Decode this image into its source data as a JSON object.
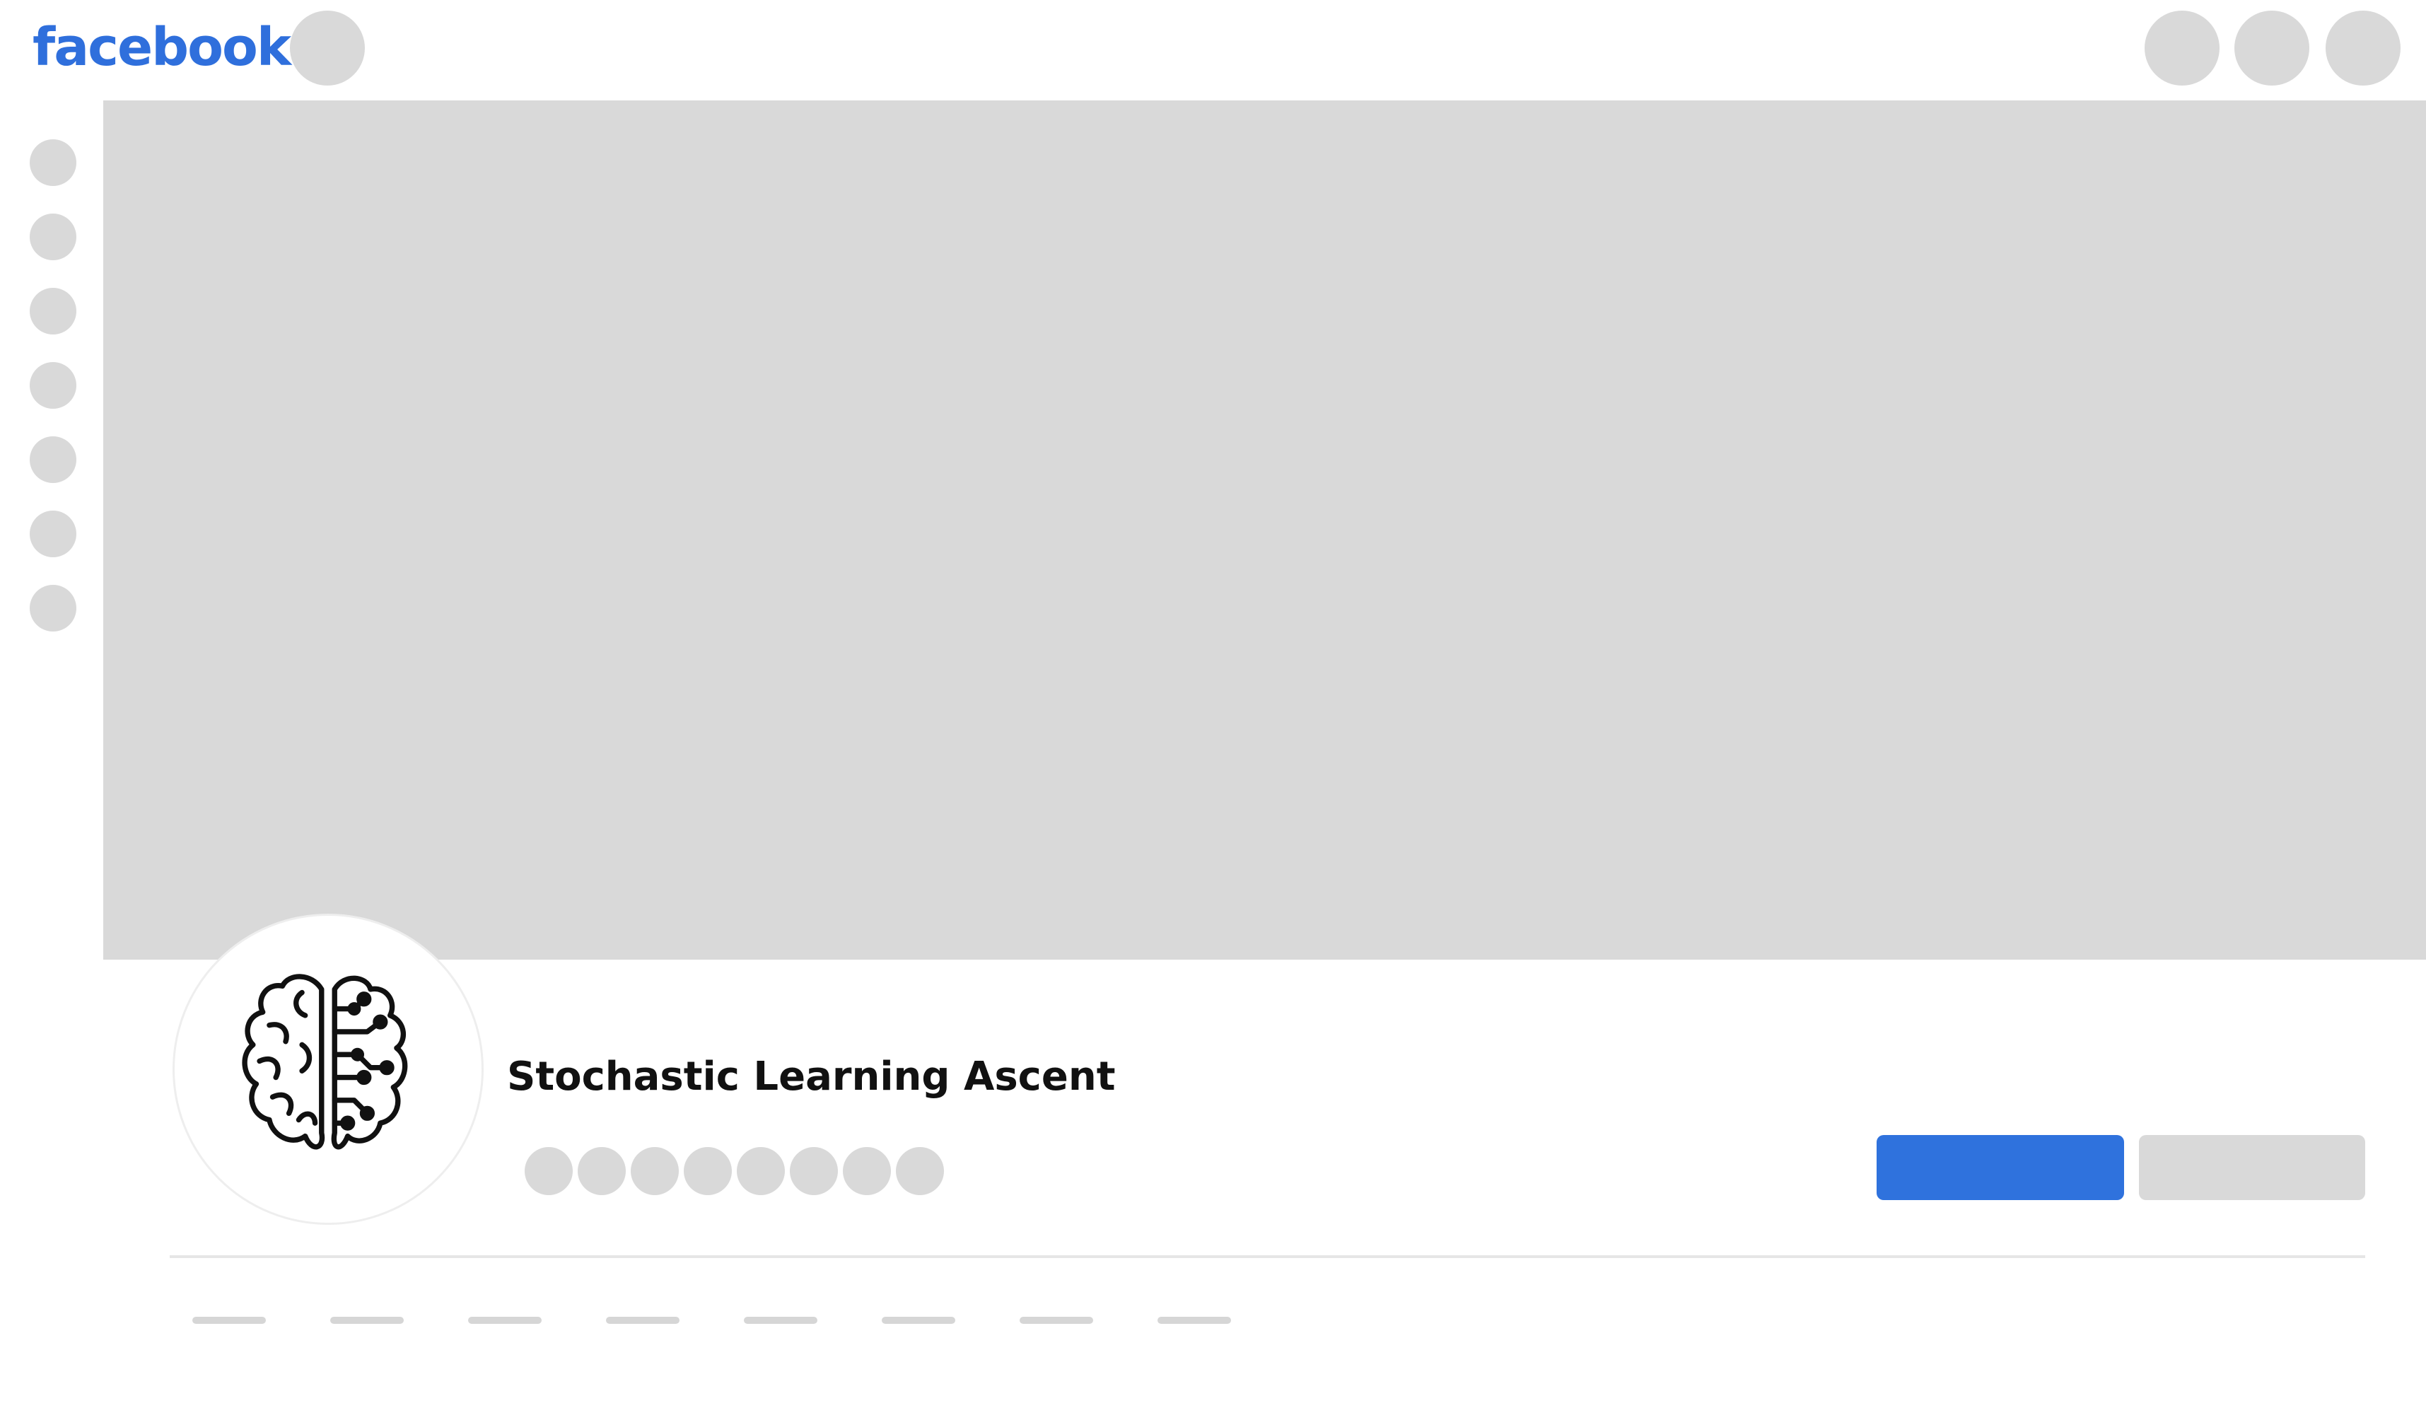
{
  "header": {
    "logo_text": "facebook",
    "brand_color": "#2f6fdc"
  },
  "profile": {
    "name": "Stochastic Learning Ascent",
    "avatar_icon": "brain-circuit-icon"
  },
  "colors": {
    "placeholder": "#d9d9d9",
    "primary_button": "#2f72dd"
  }
}
